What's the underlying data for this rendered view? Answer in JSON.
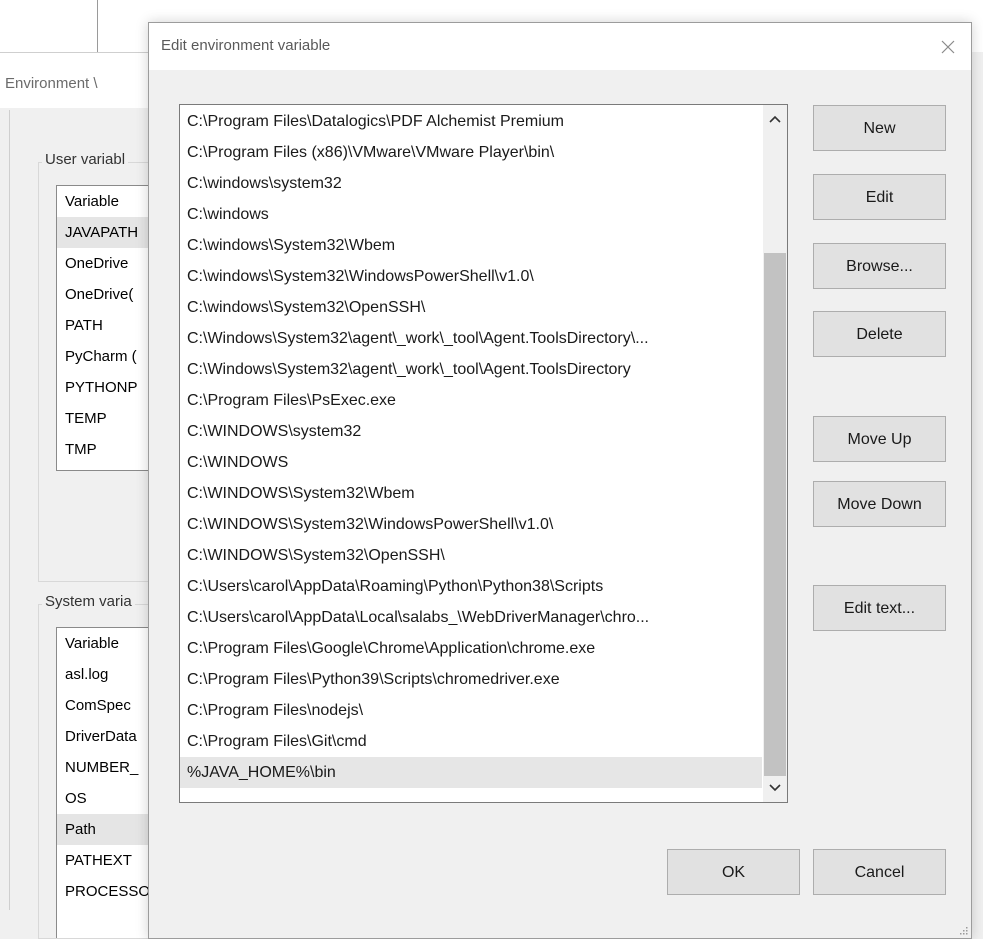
{
  "background_window": {
    "title": "Environment \\",
    "user_group_label": "User variabl",
    "user_vars": [
      "Variable",
      "JAVAPATH",
      "OneDrive",
      "OneDrive(",
      "PATH",
      "PyCharm (",
      "PYTHONP",
      "TEMP",
      "TMP"
    ],
    "system_group_label": "System varia",
    "system_vars": [
      "Variable",
      "asl.log",
      "ComSpec",
      "DriverData",
      "NUMBER_",
      "OS",
      "Path",
      "PATHEXT",
      "PROCESSO"
    ]
  },
  "dialog": {
    "title": "Edit environment variable",
    "paths": [
      "C:\\Program Files\\Datalogics\\PDF Alchemist Premium",
      "C:\\Program Files (x86)\\VMware\\VMware Player\\bin\\",
      "C:\\windows\\system32",
      "C:\\windows",
      "C:\\windows\\System32\\Wbem",
      "C:\\windows\\System32\\WindowsPowerShell\\v1.0\\",
      "C:\\windows\\System32\\OpenSSH\\",
      "C:\\Windows\\System32\\agent\\_work\\_tool\\Agent.ToolsDirectory\\...",
      "C:\\Windows\\System32\\agent\\_work\\_tool\\Agent.ToolsDirectory",
      "C:\\Program Files\\PsExec.exe",
      "C:\\WINDOWS\\system32",
      "C:\\WINDOWS",
      "C:\\WINDOWS\\System32\\Wbem",
      "C:\\WINDOWS\\System32\\WindowsPowerShell\\v1.0\\",
      "C:\\WINDOWS\\System32\\OpenSSH\\",
      "C:\\Users\\carol\\AppData\\Roaming\\Python\\Python38\\Scripts",
      "C:\\Users\\carol\\AppData\\Local\\salabs_\\WebDriverManager\\chro...",
      "C:\\Program Files\\Google\\Chrome\\Application\\chrome.exe",
      "C:\\Program Files\\Python39\\Scripts\\chromedriver.exe",
      "C:\\Program Files\\nodejs\\",
      "C:\\Program Files\\Git\\cmd",
      "%JAVA_HOME%\\bin"
    ],
    "selected_path_index": 21,
    "buttons": {
      "new": "New",
      "edit": "Edit",
      "browse": "Browse...",
      "delete": "Delete",
      "move_up": "Move Up",
      "move_down": "Move Down",
      "edit_text": "Edit text...",
      "ok": "OK",
      "cancel": "Cancel"
    }
  }
}
